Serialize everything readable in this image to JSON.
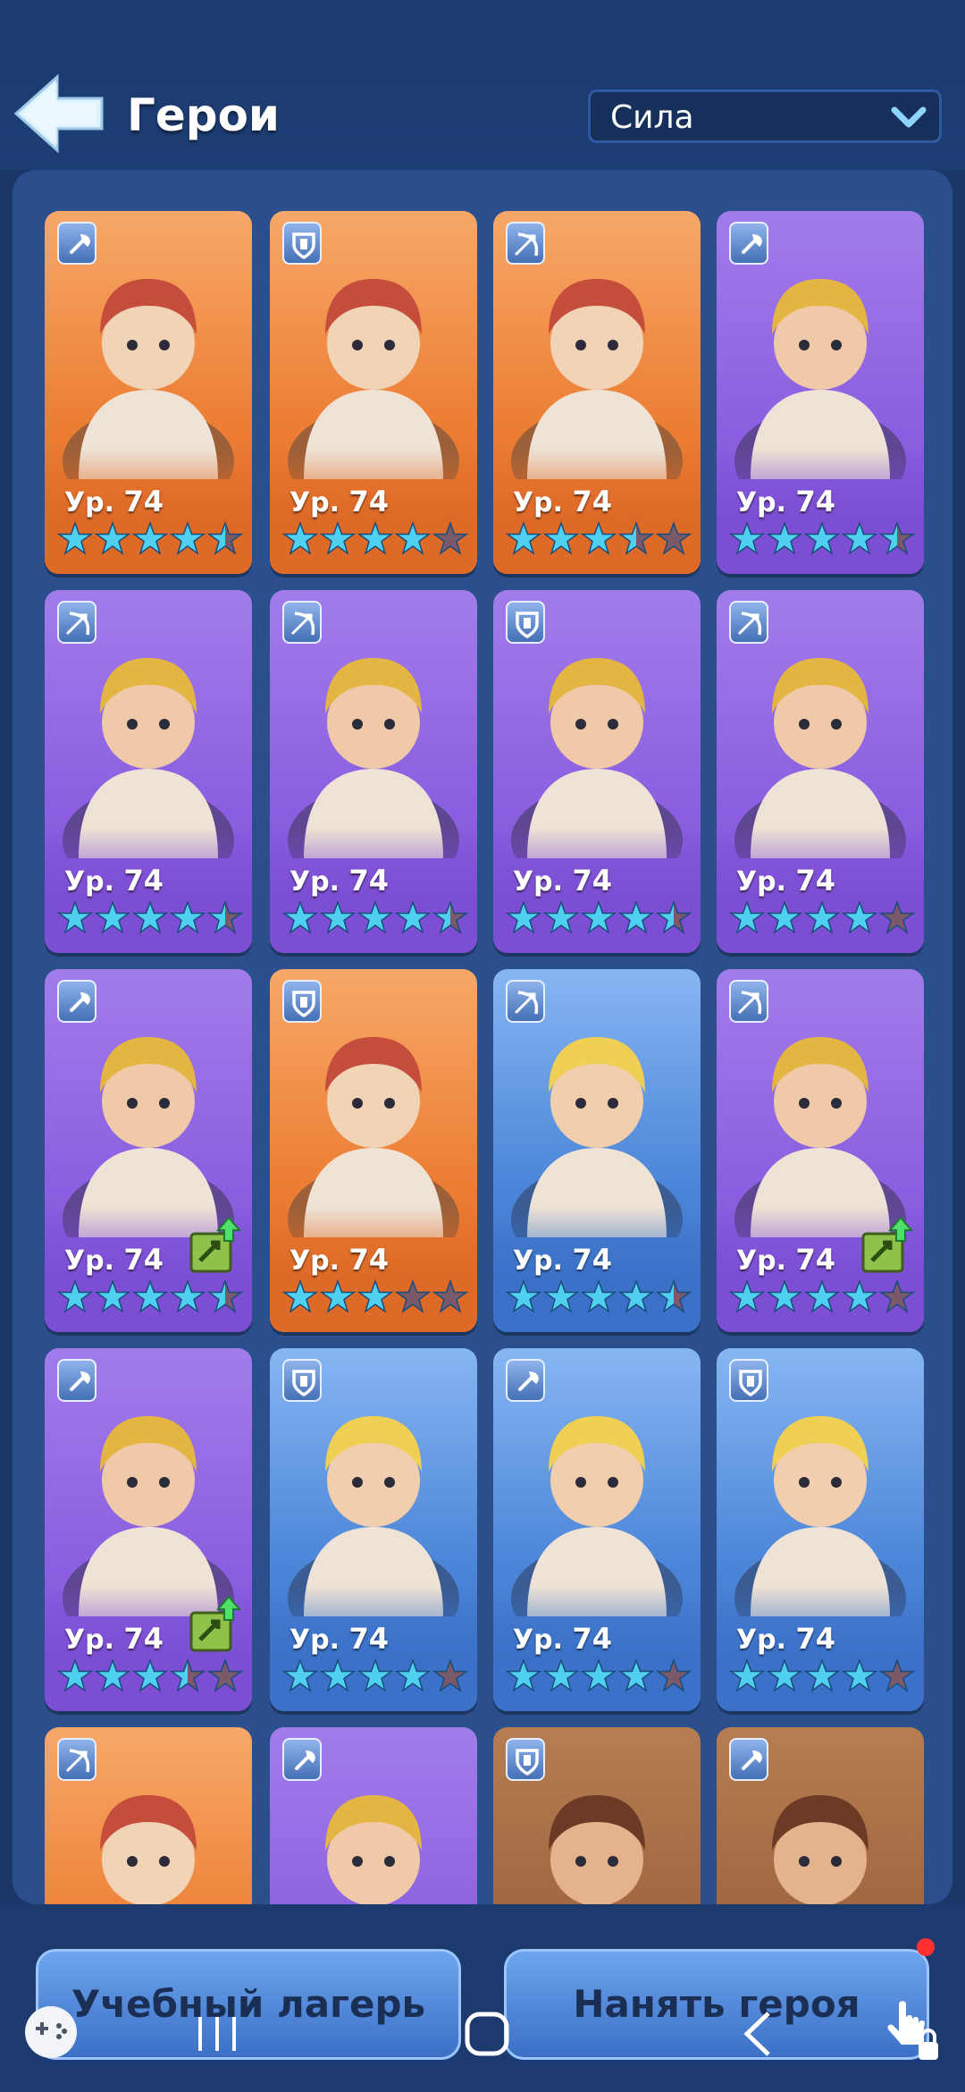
{
  "header": {
    "title": "Герои",
    "back_icon": "back-arrow-icon"
  },
  "sort": {
    "selected": "Сила"
  },
  "heroes": [
    {
      "level_prefix": "Ур.",
      "level": "74",
      "bg": "orange",
      "class": "axe",
      "stars": 4.5,
      "upgrade": false
    },
    {
      "level_prefix": "Ур.",
      "level": "74",
      "bg": "orange",
      "class": "shield",
      "stars": 4,
      "upgrade": false
    },
    {
      "level_prefix": "Ур.",
      "level": "74",
      "bg": "orange",
      "class": "bow",
      "stars": 3.5,
      "upgrade": false
    },
    {
      "level_prefix": "Ур.",
      "level": "74",
      "bg": "purple",
      "class": "axe",
      "stars": 4.5,
      "upgrade": false
    },
    {
      "level_prefix": "Ур.",
      "level": "74",
      "bg": "purple",
      "class": "bow",
      "stars": 4.5,
      "upgrade": false
    },
    {
      "level_prefix": "Ур.",
      "level": "74",
      "bg": "purple",
      "class": "bow",
      "stars": 4.5,
      "upgrade": false
    },
    {
      "level_prefix": "Ур.",
      "level": "74",
      "bg": "purple",
      "class": "shield",
      "stars": 4.5,
      "upgrade": false
    },
    {
      "level_prefix": "Ур.",
      "level": "74",
      "bg": "purple",
      "class": "bow",
      "stars": 4,
      "upgrade": false
    },
    {
      "level_prefix": "Ур.",
      "level": "74",
      "bg": "purple",
      "class": "axe",
      "stars": 4.5,
      "upgrade": true
    },
    {
      "level_prefix": "Ур.",
      "level": "74",
      "bg": "orange",
      "class": "shield",
      "stars": 3,
      "upgrade": false
    },
    {
      "level_prefix": "Ур.",
      "level": "74",
      "bg": "blue",
      "class": "bow",
      "stars": 4.5,
      "upgrade": false
    },
    {
      "level_prefix": "Ур.",
      "level": "74",
      "bg": "purple",
      "class": "bow",
      "stars": 4,
      "upgrade": true
    },
    {
      "level_prefix": "Ур.",
      "level": "74",
      "bg": "purple",
      "class": "axe",
      "stars": 3.5,
      "upgrade": true
    },
    {
      "level_prefix": "Ур.",
      "level": "74",
      "bg": "blue",
      "class": "shield",
      "stars": 4,
      "upgrade": false
    },
    {
      "level_prefix": "Ур.",
      "level": "74",
      "bg": "blue",
      "class": "axe",
      "stars": 4,
      "upgrade": false
    },
    {
      "level_prefix": "Ур.",
      "level": "74",
      "bg": "blue",
      "class": "shield",
      "stars": 4,
      "upgrade": false
    },
    {
      "bg": "orange",
      "class": "bow"
    },
    {
      "bg": "purple",
      "class": "axe"
    },
    {
      "bg": "brown",
      "class": "shield"
    },
    {
      "bg": "brown",
      "class": "axe"
    }
  ],
  "buttons": {
    "training_camp": "Учебный лагерь",
    "hire_hero": "Нанять героя"
  },
  "colors": {
    "star_on": "#4fd0f0",
    "star_off": "#7a5a6a",
    "panel": "#2a4f8c",
    "background": "#1a3768"
  }
}
